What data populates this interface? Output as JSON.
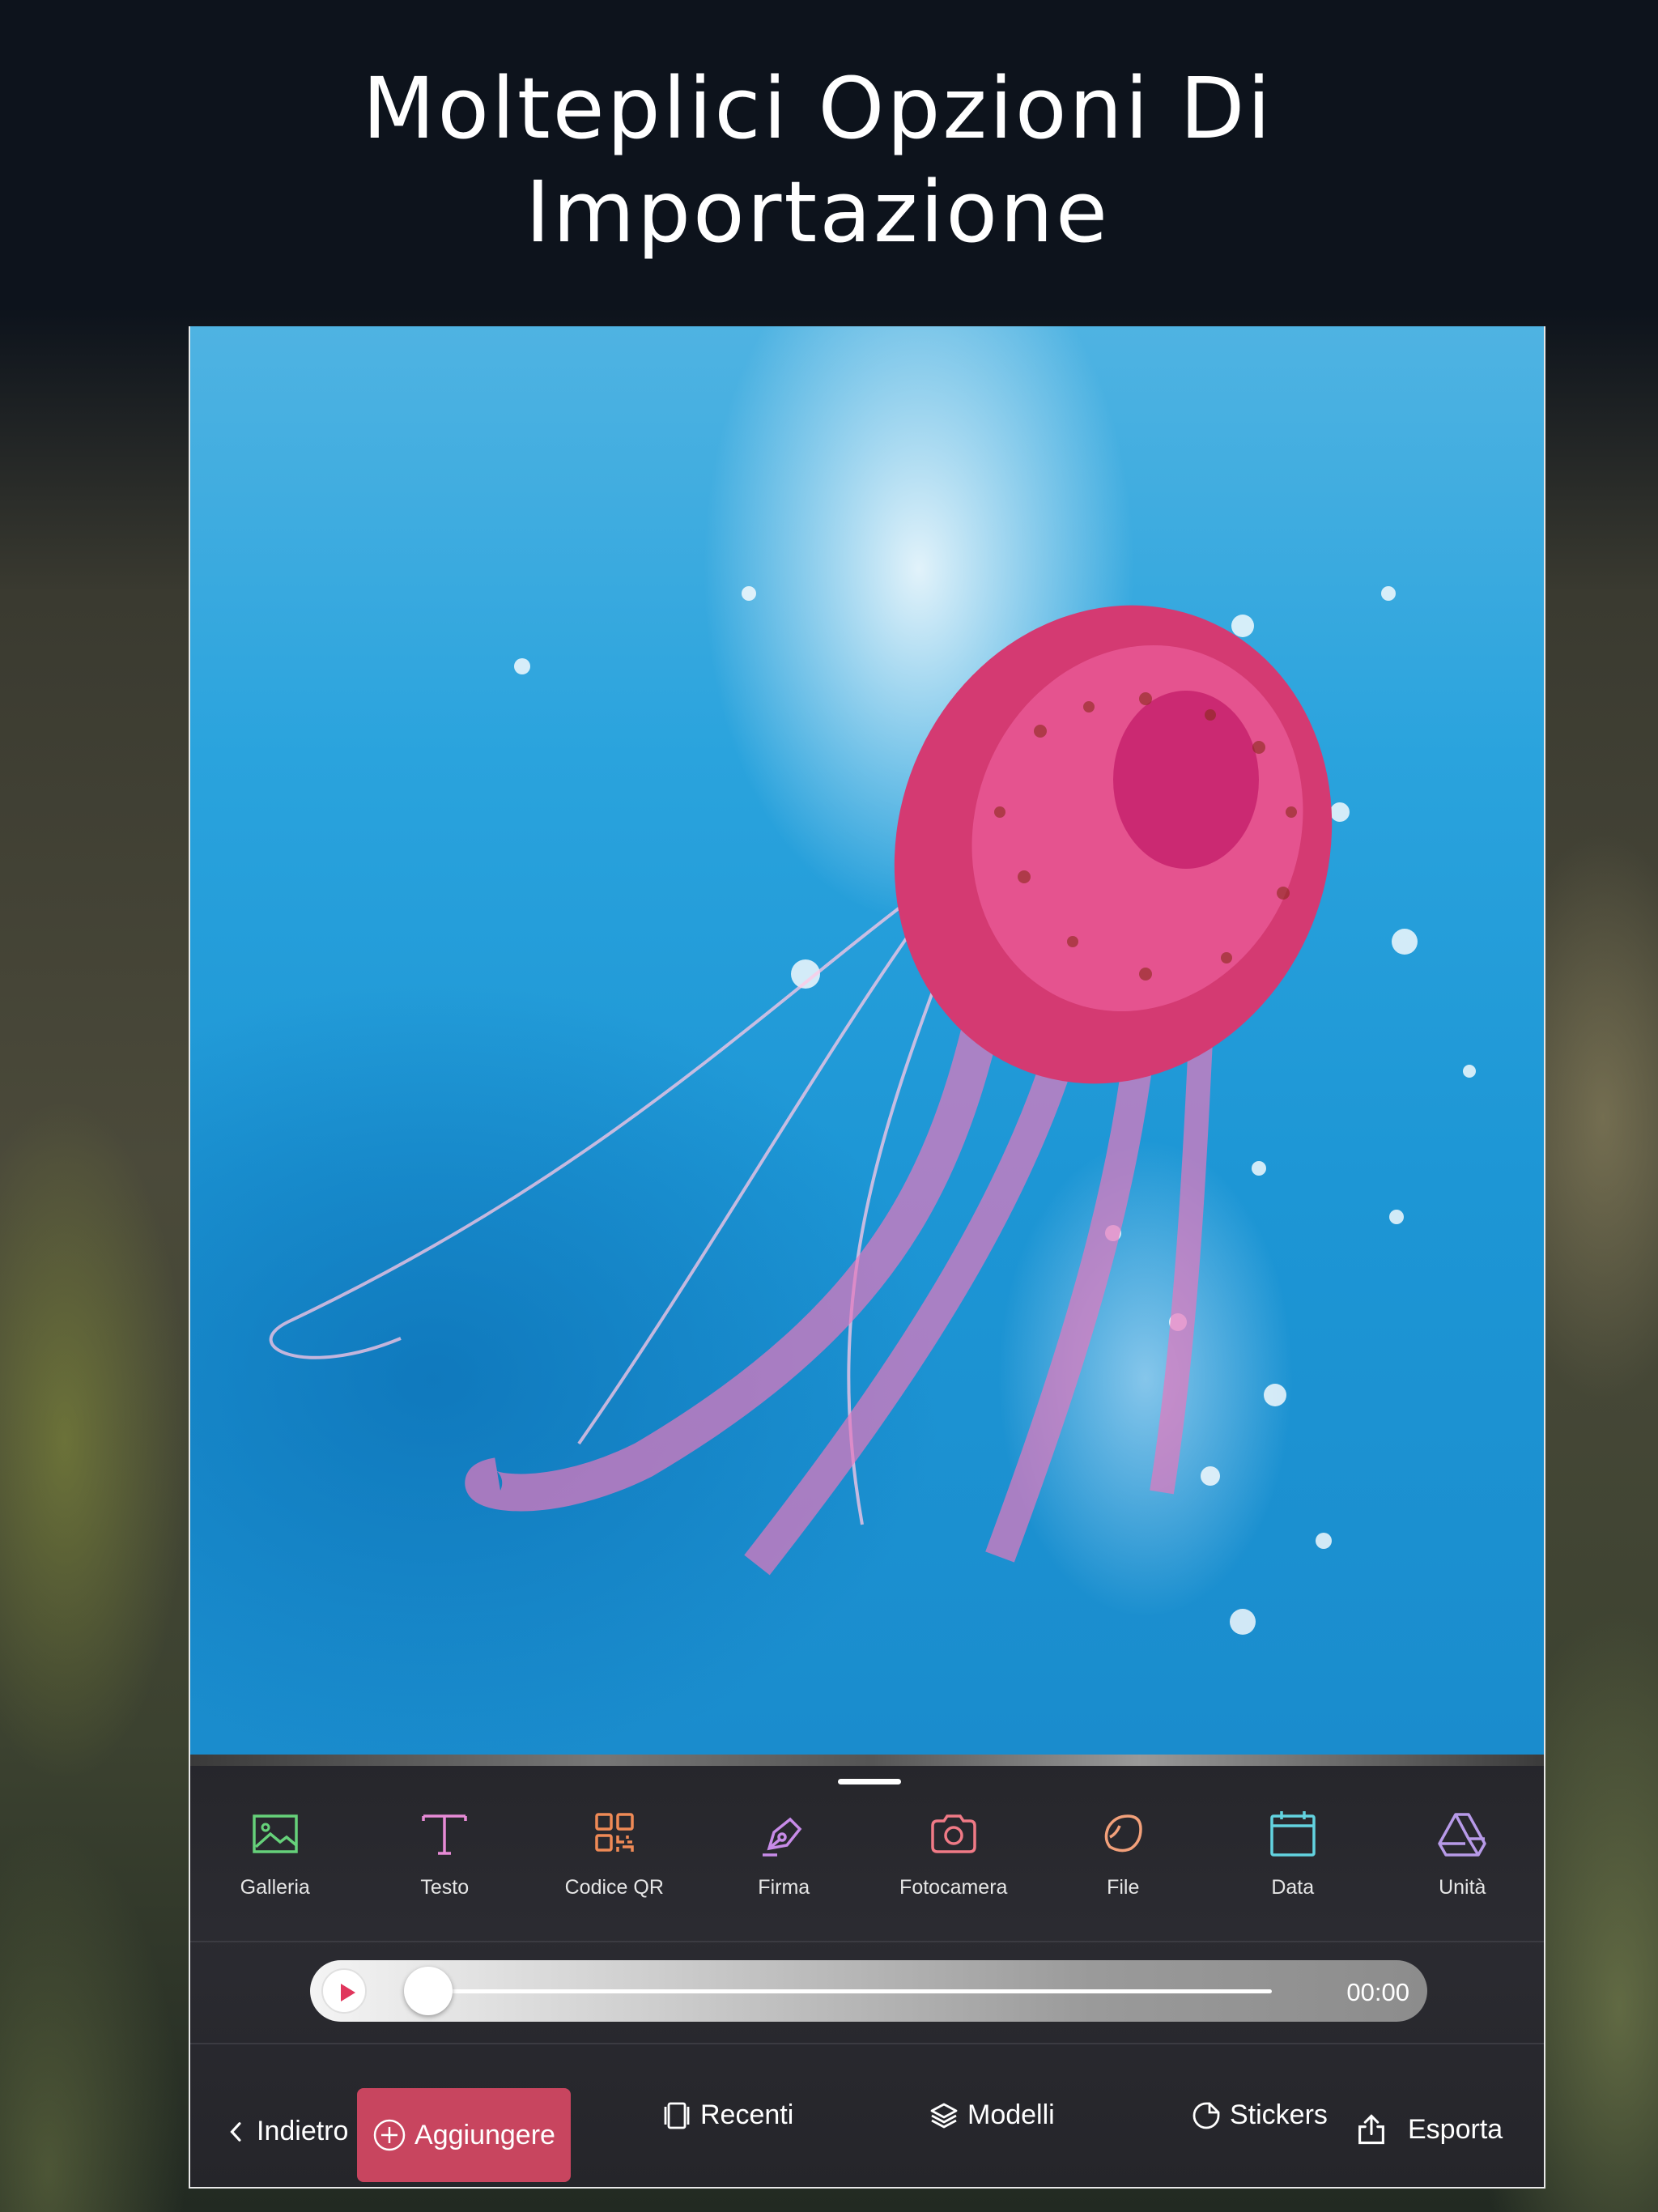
{
  "headline": {
    "line1": "Molteplici Opzioni Di",
    "line2": "Importazione"
  },
  "tools": [
    {
      "label": "Galleria",
      "icon": "gallery-icon",
      "color": "#66d17a"
    },
    {
      "label": "Testo",
      "icon": "text-icon",
      "color": "#e78bd6"
    },
    {
      "label": "Codice QR",
      "icon": "qr-code-icon",
      "color": "#ef8a56"
    },
    {
      "label": "Firma",
      "icon": "signature-pen-icon",
      "color": "#c78be8"
    },
    {
      "label": "Fotocamera",
      "icon": "camera-icon",
      "color": "#f07a86"
    },
    {
      "label": "File",
      "icon": "file-icon",
      "color": "#f2a07a"
    },
    {
      "label": "Data",
      "icon": "calendar-icon",
      "color": "#63d3e0"
    },
    {
      "label": "Unità",
      "icon": "drive-icon",
      "color": "#b79ae8"
    }
  ],
  "timeline": {
    "time": "00:00",
    "progress": 0,
    "accent": "#e0365c"
  },
  "bottom_bar": {
    "back_label": "Indietro",
    "add_label": "Aggiungere",
    "recent_label": "Recenti",
    "templates_label": "Modelli",
    "stickers_label": "Stickers",
    "export_label": "Esporta",
    "add_color": "#c8455f"
  }
}
